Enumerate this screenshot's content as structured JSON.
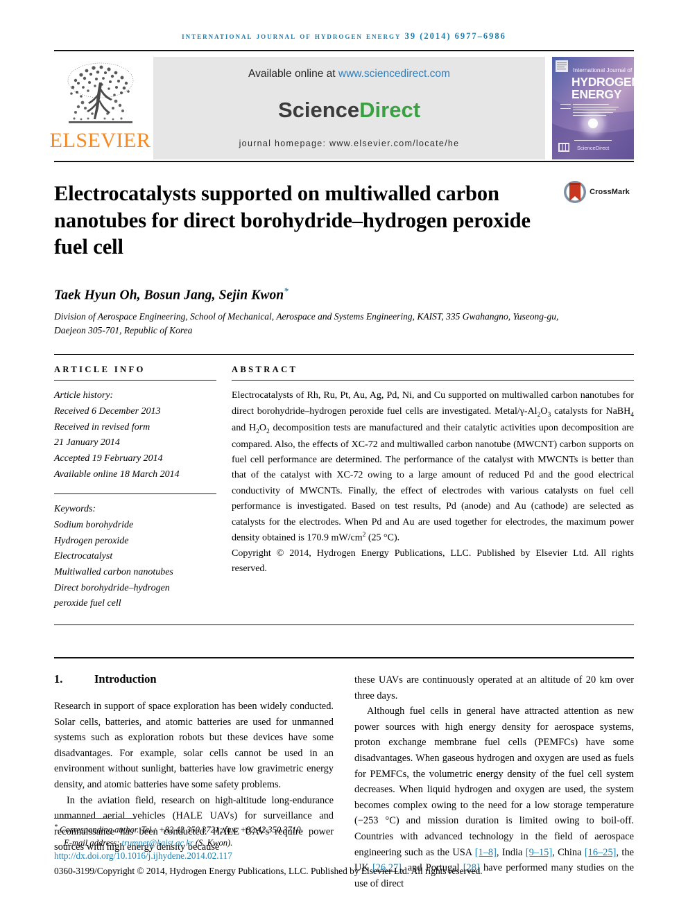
{
  "running_head": "International Journal of Hydrogen Energy 39 (2014) 6977–6986",
  "masthead": {
    "publisher_name": "ELSEVIER",
    "available_prefix": "Available online at ",
    "available_url": "www.sciencedirect.com",
    "sciencedirect_part1": "Science",
    "sciencedirect_part2": "Direct",
    "journal_homepage": "journal homepage: www.elsevier.com/locate/he",
    "cover": {
      "line1": "International Journal of",
      "line2": "HYDROGEN",
      "line3": "ENERGY",
      "editor_block": "Editor-in-Chief: T. Nejat Veziroğlu   Associate Editors: A. Hashimi, D.G. Dunikov, S.A. Sherif, A.Z. Masoko, J.W. Sheffield, J.A. Turner and J.S. Antoniadis",
      "footer_mark": "IJHE  ScienceDirect"
    }
  },
  "article": {
    "title": "Electrocatalysts supported on multiwalled carbon nanotubes for direct borohydride–hydrogen peroxide fuel cell",
    "crossmark_label": "CrossMark",
    "authors": "Taek Hyun Oh, Bosun Jang, Sejin Kwon",
    "corresponding_marker": "*",
    "affiliation": "Division of Aerospace Engineering, School of Mechanical, Aerospace and Systems Engineering, KAIST, 335 Gwahangno, Yuseong-gu, Daejeon 305-701, Republic of Korea"
  },
  "article_info": {
    "heading": "ARTICLE INFO",
    "history_label": "Article history:",
    "history": [
      "Received 6 December 2013",
      "Received in revised form",
      "21 January 2014",
      "Accepted 19 February 2014",
      "Available online 18 March 2014"
    ],
    "keywords_label": "Keywords:",
    "keywords": [
      "Sodium borohydride",
      "Hydrogen peroxide",
      "Electrocatalyst",
      "Multiwalled carbon nanotubes",
      "Direct borohydride–hydrogen",
      "peroxide fuel cell"
    ]
  },
  "abstract": {
    "heading": "ABSTRACT",
    "paragraph_parts": {
      "p1": "Electrocatalysts of Rh, Ru, Pt, Au, Ag, Pd, Ni, and Cu supported on multiwalled carbon nanotubes for direct borohydride–hydrogen peroxide fuel cells are investigated. Metal/γ-Al",
      "p2": "O",
      "p3": " catalysts for NaBH",
      "p4": " and H",
      "p5": "O",
      "p6": " decomposition tests are manufactured and their catalytic activities upon decomposition are compared. Also, the effects of XC-72 and multiwalled carbon nanotube (MWCNT) carbon supports on fuel cell performance are determined. The performance of the catalyst with MWCNTs is better than that of the catalyst with XC-72 owing to a large amount of reduced Pd and the good electrical conductivity of MWCNTs. Finally, the effect of electrodes with various catalysts on fuel cell performance is investigated. Based on test results, Pd (anode) and Au (cathode) are selected as catalysts for the electrodes. When Pd and Au are used together for electrodes, the maximum power density obtained is 170.9 mW/cm",
      "p7": " (25 °C)."
    },
    "sub_al2o3_2": "2",
    "sub_al2o3_3": "3",
    "sub_nabh4": "4",
    "sub_h2o2_h": "2",
    "sub_h2o2_o": "2",
    "sup_cm2": "2",
    "copyright": "Copyright © 2014, Hydrogen Energy Publications, LLC. Published by Elsevier Ltd. All rights reserved."
  },
  "body": {
    "section_number": "1.",
    "section_title": "Introduction",
    "col1_p1": "Research in support of space exploration has been widely conducted. Solar cells, batteries, and atomic batteries are used for unmanned systems such as exploration robots but these devices have some disadvantages. For example, solar cells cannot be used in an environment without sunlight, batteries have low gravimetric energy density, and atomic batteries have some safety problems.",
    "col1_p2": "In the aviation field, research on high-altitude long-endurance unmanned aerial vehicles (HALE UAVs) for surveillance and reconnaissance has been conducted. HALE UAVs require power sources with high energy density because",
    "col2_p1": "these UAVs are continuously operated at an altitude of 20 km over three days.",
    "col2_p2_a": "Although fuel cells in general have attracted attention as new power sources with high energy density for aerospace systems, proton exchange membrane fuel cells (PEMFCs) have some disadvantages. When gaseous hydrogen and oxygen are used as fuels for PEMFCs, the volumetric energy density of the fuel cell system decreases. When liquid hydrogen and oxygen are used, the system becomes complex owing to the need for a low storage temperature (−253 °C) and mission duration is limited owing to boil-off. Countries with advanced technology in the field of aerospace engineering such as the USA ",
    "col2_cite1": "[1–8]",
    "col2_p2_b": ", India ",
    "col2_cite2": "[9–15]",
    "col2_p2_c": ", China ",
    "col2_cite3": "[16–25]",
    "col2_p2_d": ", the UK ",
    "col2_cite4": "[26,27]",
    "col2_p2_e": ", and Portugal ",
    "col2_cite5": "[28]",
    "col2_p2_f": " have performed many studies on the use of direct"
  },
  "footer": {
    "corresponding_note": "Corresponding author. Tel.: +82 42 350 3721; fax: +82 42 350 3710.",
    "email_label": "E-mail address: ",
    "email": "trumpet@kaist.ac.kr",
    "email_suffix": " (S. Kwon).",
    "doi": "http://dx.doi.org/10.1016/j.ijhydene.2014.02.117",
    "issn_line": "0360-3199/Copyright © 2014, Hydrogen Energy Publications, LLC. Published by Elsevier Ltd. All rights reserved."
  },
  "colors": {
    "link_blue": "#1b7eb0",
    "elsevier_orange": "#f7881f",
    "sciencedirect_green": "#3aa043",
    "banner_grey": "#e6e6e6"
  }
}
